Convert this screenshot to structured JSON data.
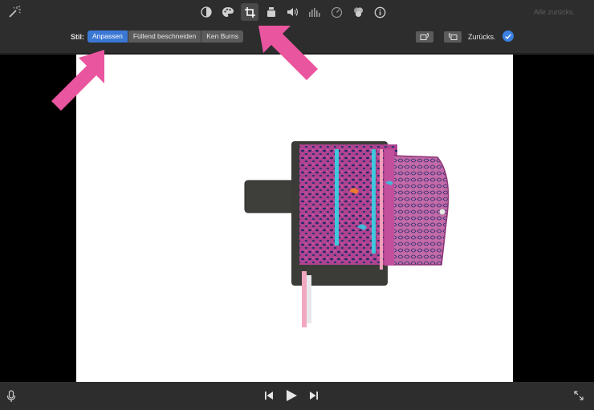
{
  "toolbar": {
    "tools": [
      "magic-wand-icon",
      "color-balance-icon",
      "color-palette-icon",
      "crop-icon",
      "camera-icon",
      "volume-icon",
      "equalizer-icon",
      "speed-icon",
      "filter-icon",
      "info-icon"
    ],
    "active_tool": "crop-icon",
    "reset_all_label": "Alle zurücks."
  },
  "style_bar": {
    "label": "Stil:",
    "options": [
      "Anpassen",
      "Füllend beschneiden",
      "Ken Burns"
    ],
    "selected": "Anpassen",
    "reset_label": "Zurücks.",
    "accent_color": "#3b78d4"
  },
  "bottom_bar": {
    "icons": [
      "microphone-icon",
      "skip-back-icon",
      "play-icon",
      "skip-forward-icon",
      "fullscreen-icon"
    ]
  },
  "annotation_color": "#e9559f"
}
